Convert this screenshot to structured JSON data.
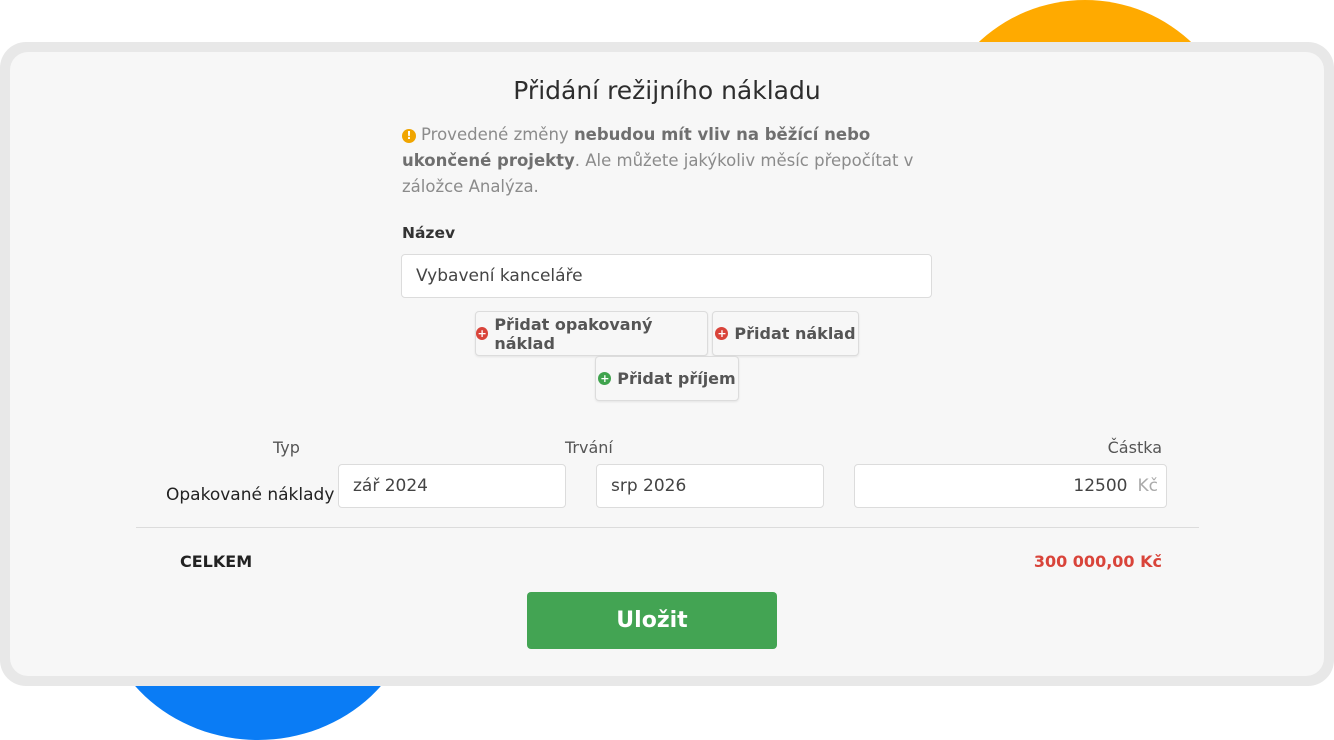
{
  "colors": {
    "accent_orange": "#FFAA00",
    "accent_blue": "#0A7CF5",
    "primary_green": "#43A453",
    "danger_red": "#D9443A",
    "warning_yellow": "#F0A500"
  },
  "modal": {
    "title": "Přidání režijního nákladu",
    "notice": {
      "icon": "exclamation-circle-icon",
      "part1": "Provedené změny ",
      "bold1": "nebudou mít vliv na běžící nebo ukončené projekty",
      "part2": ". Ale můžete jakýkoliv měsíc přepočítat v záložce Analýza."
    },
    "name": {
      "label": "Název",
      "value": "Vybavení kanceláře"
    },
    "buttons": {
      "add_recurring_cost": "Přidat opakovaný náklad",
      "add_cost": "Přidat náklad",
      "add_income": "Přidat příjem"
    },
    "table": {
      "headers": {
        "type": "Typ",
        "duration": "Trvání",
        "amount": "Částka"
      },
      "rows": [
        {
          "type": "Opakované náklady",
          "from": "zář 2024",
          "to": "srp 2026",
          "amount": "12500",
          "currency": "Kč"
        }
      ]
    },
    "total": {
      "label": "CELKEM",
      "value": "300 000,00 Kč"
    },
    "save_label": "Uložit"
  }
}
